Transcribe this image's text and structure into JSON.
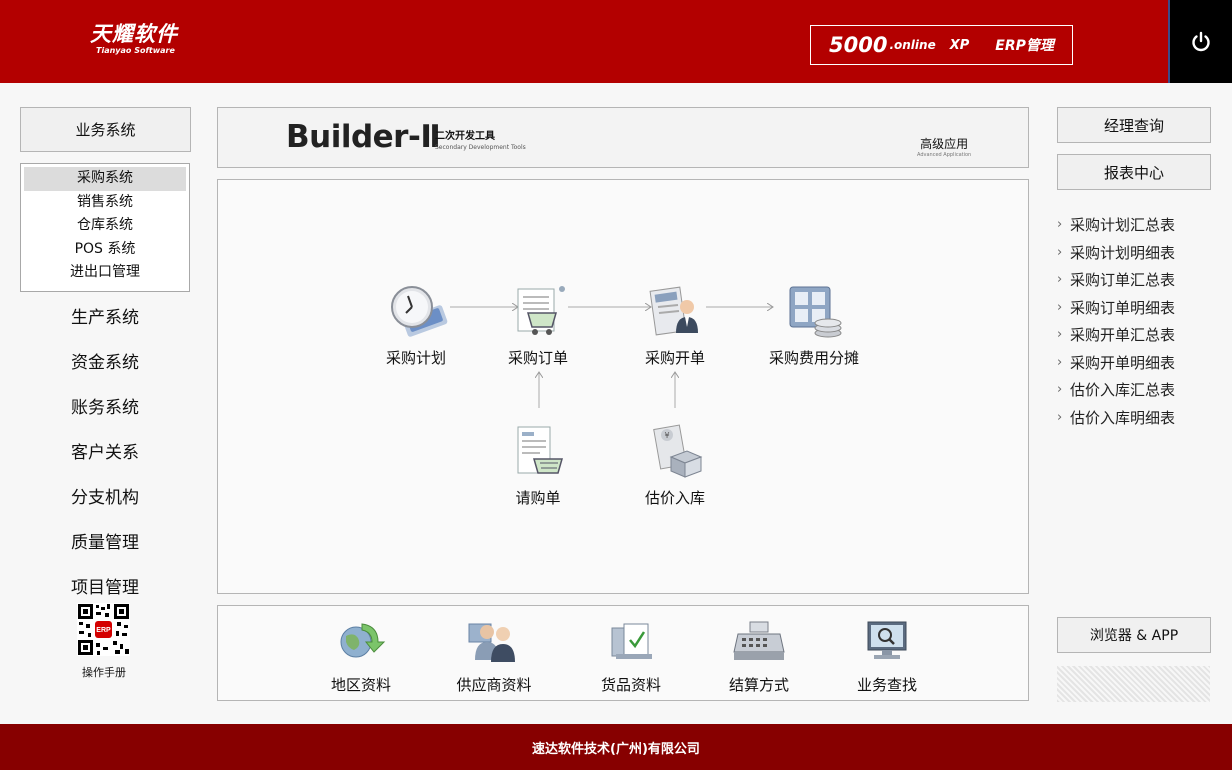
{
  "header": {
    "logo_cn": "天耀软件",
    "logo_en": "Tianyao Software",
    "product_num": "5000",
    "product_online": ".online",
    "product_xp": "XP",
    "product_erp": "ERP管理",
    "power_icon": "power-icon"
  },
  "left": {
    "business_system": "业务系统",
    "subsystems": [
      "采购系统",
      "销售系统",
      "仓库系统",
      "POS 系统",
      "进出口管理"
    ],
    "active_subsystem": 0,
    "systems": [
      "生产系统",
      "资金系统",
      "账务系统",
      "客户关系",
      "分支机构",
      "质量管理",
      "项目管理"
    ],
    "qr_badge": "ERP",
    "manual": "操作手册"
  },
  "banner": {
    "title": "Builder-Ⅱ",
    "sub_cn": "二次开发工具",
    "sub_en": "Secondary Development Tools",
    "advanced_cn": "高级应用",
    "advanced_en": "Advanced Application"
  },
  "flow": {
    "purchase_plan": "采购计划",
    "purchase_order": "采购订单",
    "purchase_invoice": "采购开单",
    "cost_allocation": "采购费用分摊",
    "requisition": "请购单",
    "estimated_stock_in": "估价入库"
  },
  "base_data": [
    "地区资料",
    "供应商资料",
    "货品资料",
    "结算方式",
    "业务查找"
  ],
  "right": {
    "manager_query": "经理查询",
    "report_center": "报表中心",
    "reports": [
      "采购计划汇总表",
      "采购计划明细表",
      "采购订单汇总表",
      "采购订单明细表",
      "采购开单汇总表",
      "采购开单明细表",
      "估价入库汇总表",
      "估价入库明细表"
    ],
    "browser_app": "浏览器 & APP"
  },
  "footer": {
    "company": "速达软件技术(广州)有限公司"
  },
  "colors": {
    "header_red": "#b30000",
    "footer_red": "#870000"
  }
}
